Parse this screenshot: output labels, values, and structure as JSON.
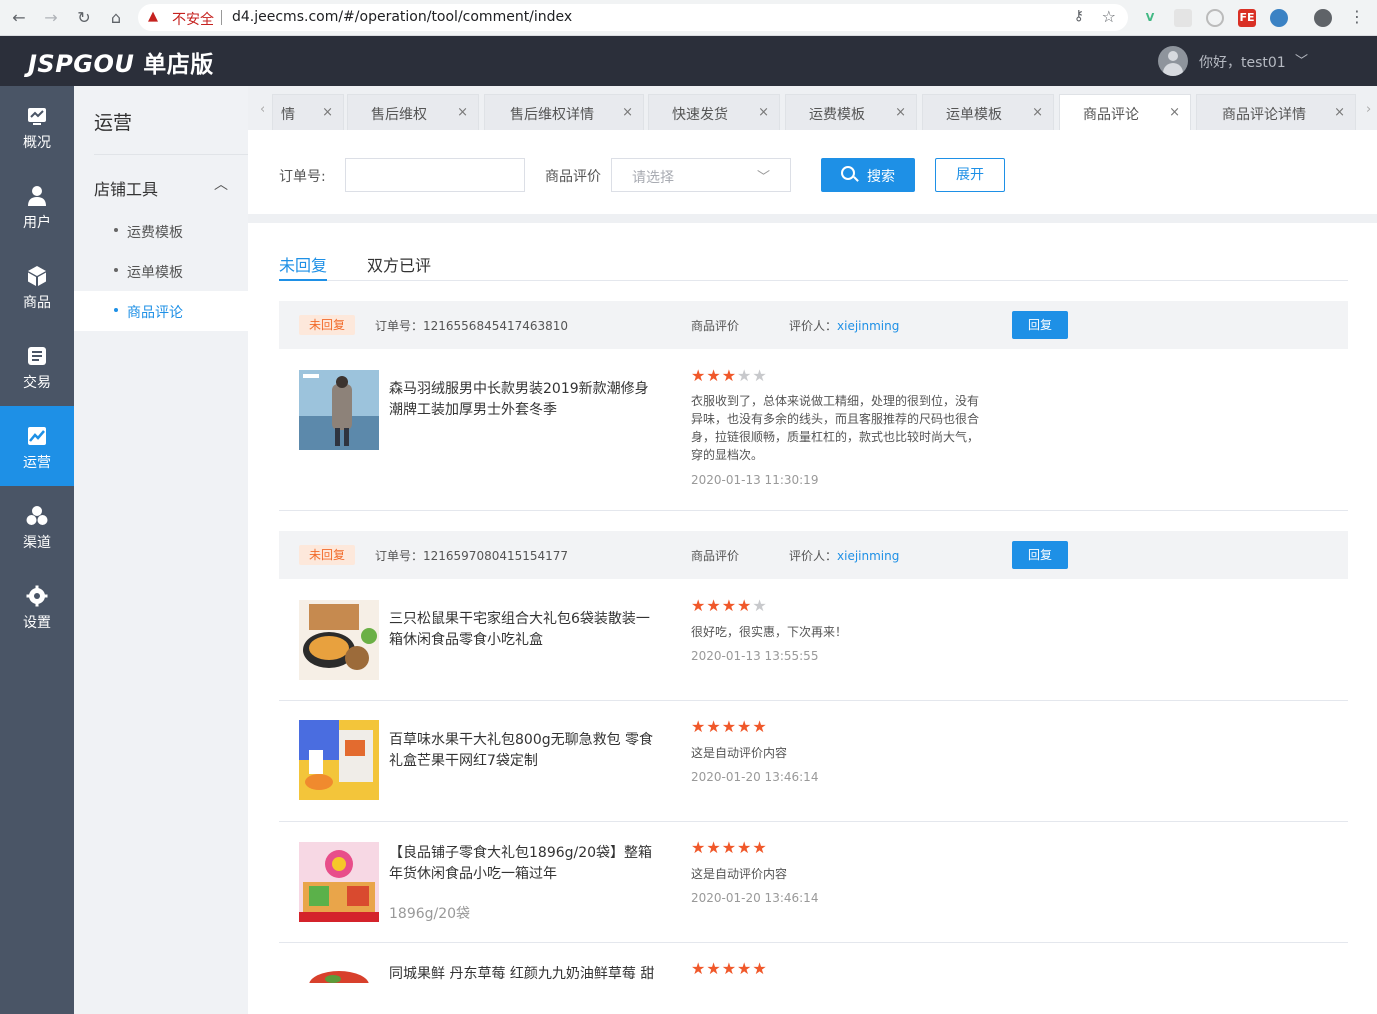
{
  "browser": {
    "insecure_label": "不安全",
    "url": "d4.jeecms.com/#/operation/tool/comment/index"
  },
  "header": {
    "logo": "JSPGOU",
    "logo_cn": "单店版",
    "greeting": "你好，test01"
  },
  "leftnav": {
    "items": [
      {
        "label": "概况",
        "icon": "dashboard-icon"
      },
      {
        "label": "用户",
        "icon": "user-icon"
      },
      {
        "label": "商品",
        "icon": "cube-icon"
      },
      {
        "label": "交易",
        "icon": "list-icon"
      },
      {
        "label": "运营",
        "icon": "chart-icon"
      },
      {
        "label": "渠道",
        "icon": "cluster-icon"
      },
      {
        "label": "设置",
        "icon": "gear-icon"
      }
    ]
  },
  "subnav": {
    "title": "运营",
    "group": "店铺工具",
    "items": [
      {
        "label": "运费模板"
      },
      {
        "label": "运单模板"
      },
      {
        "label": "商品评论"
      }
    ]
  },
  "tabs": [
    {
      "label": "情"
    },
    {
      "label": "售后维权"
    },
    {
      "label": "售后维权详情"
    },
    {
      "label": "快速发货"
    },
    {
      "label": "运费模板"
    },
    {
      "label": "运单模板"
    },
    {
      "label": "商品评论"
    },
    {
      "label": "商品评论详情"
    }
  ],
  "filter": {
    "order_label": "订单号:",
    "order_value": "",
    "rating_label": "商品评价",
    "rating_placeholder": "请选择",
    "search_label": "搜索",
    "expand_label": "展开"
  },
  "content_tabs": [
    {
      "label": "未回复"
    },
    {
      "label": "双方已评"
    }
  ],
  "orders": [
    {
      "badge": "未回复",
      "order_no": "订单号：1216556845417463810",
      "rating_label": "商品评价",
      "reviewer_label": "评价人：",
      "reviewer": "xiejinming",
      "reply_label": "回复",
      "items": [
        {
          "name": "森马羽绒服男中长款男装2019新款潮修身潮牌工装加厚男士外套冬季",
          "spec": "",
          "stars": 3,
          "comment": "衣服收到了，总体来说做工精细，处理的很到位，没有异味，也没有多余的线头，而且客服推荐的尺码也很合身，拉链很顺畅，质量杠杠的，款式也比较时尚大气，穿的显档次。",
          "date": "2020-01-13 11:30:19"
        }
      ]
    },
    {
      "badge": "未回复",
      "order_no": "订单号：1216597080415154177",
      "rating_label": "商品评价",
      "reviewer_label": "评价人：",
      "reviewer": "xiejinming",
      "reply_label": "回复",
      "items": [
        {
          "name": "三只松鼠果干宅家组合大礼包6袋装散装一箱休闲食品零食小吃礼盒",
          "spec": "",
          "stars": 4,
          "comment": "很好吃，很实惠，下次再来！",
          "date": "2020-01-13 13:55:55"
        },
        {
          "name": "百草味水果干大礼包800g无聊急救包 零食礼盒芒果干网红7袋定制",
          "spec": "",
          "stars": 5,
          "comment": "这是自动评价内容",
          "date": "2020-01-20 13:46:14"
        },
        {
          "name": "【良品铺子零食大礼包1896g/20袋】整箱年货休闲食品小吃一箱过年",
          "spec": "1896g/20袋",
          "stars": 5,
          "comment": "这是自动评价内容",
          "date": "2020-01-20 13:46:14"
        },
        {
          "name": "同城果鲜 丹东草莓 红颜九九奶油鲜草莓 甜",
          "spec": "",
          "stars": 5,
          "comment": "",
          "date": ""
        }
      ]
    }
  ],
  "colors": {
    "primary": "#1e90e6",
    "star": "#f0582a",
    "badge_bg": "#fde8db",
    "badge_text": "#f26b2b"
  }
}
